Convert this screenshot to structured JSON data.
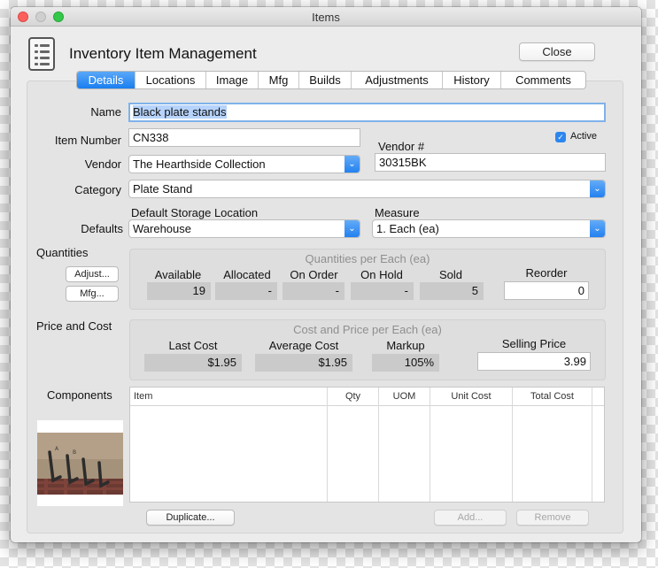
{
  "window": {
    "title": "Items"
  },
  "header": {
    "title": "Inventory Item Management",
    "close_label": "Close"
  },
  "tabs": [
    {
      "label": "Details",
      "active": true
    },
    {
      "label": "Locations"
    },
    {
      "label": "Image"
    },
    {
      "label": "Mfg"
    },
    {
      "label": "Builds"
    },
    {
      "label": "Adjustments"
    },
    {
      "label": "History"
    },
    {
      "label": "Comments"
    }
  ],
  "form": {
    "name_label": "Name",
    "name_value": "Black plate stands",
    "item_number_label": "Item Number",
    "item_number_value": "CN338",
    "active_label": "Active",
    "vendor_num_label": "Vendor #",
    "vendor_num_value": "30315BK",
    "vendor_label": "Vendor",
    "vendor_value": "The Hearthside Collection",
    "category_label": "Category",
    "category_value": "Plate Stand",
    "defaults_label": "Defaults",
    "storage_label": "Default Storage Location",
    "storage_value": "Warehouse",
    "measure_label": "Measure",
    "measure_value": "1. Each (ea)"
  },
  "quantities": {
    "label": "Quantities",
    "adjust_label": "Adjust...",
    "mfg_label": "Mfg...",
    "group_title": "Quantities per Each (ea)",
    "available_label": "Available",
    "available_value": "19",
    "allocated_label": "Allocated",
    "allocated_value": "-",
    "on_order_label": "On Order",
    "on_order_value": "-",
    "on_hold_label": "On Hold",
    "on_hold_value": "-",
    "sold_label": "Sold",
    "sold_value": "5",
    "reorder_label": "Reorder",
    "reorder_value": "0"
  },
  "price": {
    "label": "Price and Cost",
    "group_title": "Cost and Price per Each (ea)",
    "last_cost_label": "Last Cost",
    "last_cost_value": "$1.95",
    "avg_cost_label": "Average Cost",
    "avg_cost_value": "$1.95",
    "markup_label": "Markup",
    "markup_value": "105%",
    "selling_label": "Selling Price",
    "selling_value": "3.99"
  },
  "components": {
    "label": "Components",
    "columns": [
      "Item",
      "Qty",
      "UOM",
      "Unit Cost",
      "Total Cost"
    ],
    "duplicate_label": "Duplicate...",
    "add_label": "Add...",
    "remove_label": "Remove"
  },
  "colors": {
    "accent": "#1a7ef0",
    "close": "#fc605c",
    "zoom": "#34c84a"
  },
  "icons": {
    "header": "document-list-icon",
    "popup": "chevron-updown-icon",
    "check": "checkmark-icon"
  }
}
